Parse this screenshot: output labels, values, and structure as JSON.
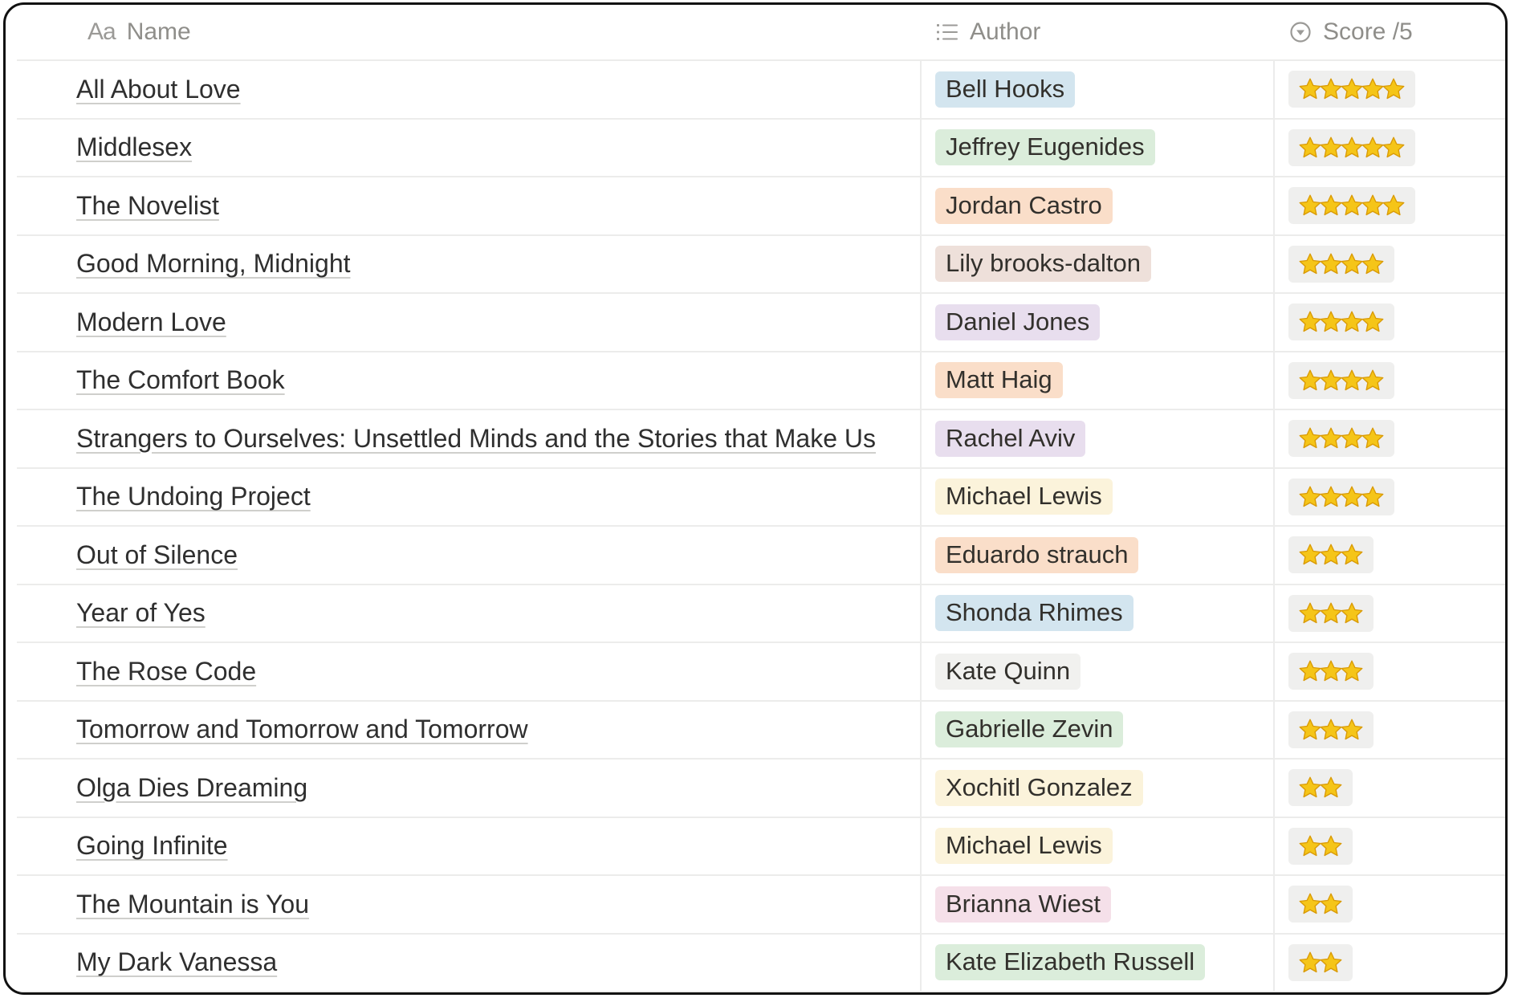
{
  "header": {
    "name_icon": "Aa",
    "name_label": "Name",
    "author_icon": "list-icon",
    "author_label": "Author",
    "score_icon": "select-icon",
    "score_label": "Score /5"
  },
  "colors": {
    "blue": "#d3e5ef",
    "green": "#dbeddb",
    "orange": "#fadec9",
    "brown": "#eee0da",
    "purple": "#e8deee",
    "yellow": "#fbf3db",
    "gray": "#f1f1ef",
    "pink": "#f5e0e9",
    "star": "#f5c518"
  },
  "rows": [
    {
      "name": "All About Love",
      "author": "Bell Hooks",
      "color": "blue",
      "score": 5
    },
    {
      "name": "Middlesex",
      "author": "Jeffrey Eugenides",
      "color": "green",
      "score": 5
    },
    {
      "name": "The Novelist",
      "author": "Jordan Castro",
      "color": "orange",
      "score": 5
    },
    {
      "name": "Good Morning, Midnight",
      "author": "Lily brooks-dalton",
      "color": "brown",
      "score": 4
    },
    {
      "name": "Modern Love",
      "author": "Daniel Jones",
      "color": "purple",
      "score": 4
    },
    {
      "name": "The Comfort Book",
      "author": "Matt Haig",
      "color": "orange",
      "score": 4
    },
    {
      "name": "Strangers to Ourselves: Unsettled Minds and the Stories that Make Us",
      "author": "Rachel Aviv",
      "color": "purple",
      "score": 4
    },
    {
      "name": "The Undoing Project",
      "author": "Michael Lewis",
      "color": "yellow",
      "score": 4
    },
    {
      "name": "Out of Silence",
      "author": "Eduardo strauch",
      "color": "orange",
      "score": 3
    },
    {
      "name": "Year of Yes",
      "author": "Shonda Rhimes",
      "color": "blue",
      "score": 3
    },
    {
      "name": "The Rose Code",
      "author": "Kate Quinn",
      "color": "gray",
      "score": 3
    },
    {
      "name": "Tomorrow and Tomorrow and Tomorrow",
      "author": "Gabrielle Zevin",
      "color": "green",
      "score": 3
    },
    {
      "name": "Olga Dies Dreaming",
      "author": "Xochitl Gonzalez",
      "color": "yellow",
      "score": 2
    },
    {
      "name": "Going Infinite",
      "author": "Michael Lewis",
      "color": "yellow",
      "score": 2
    },
    {
      "name": "The Mountain is You",
      "author": "Brianna Wiest",
      "color": "pink",
      "score": 2
    },
    {
      "name": "My Dark Vanessa",
      "author": "Kate Elizabeth Russell",
      "color": "green",
      "score": 2
    }
  ]
}
